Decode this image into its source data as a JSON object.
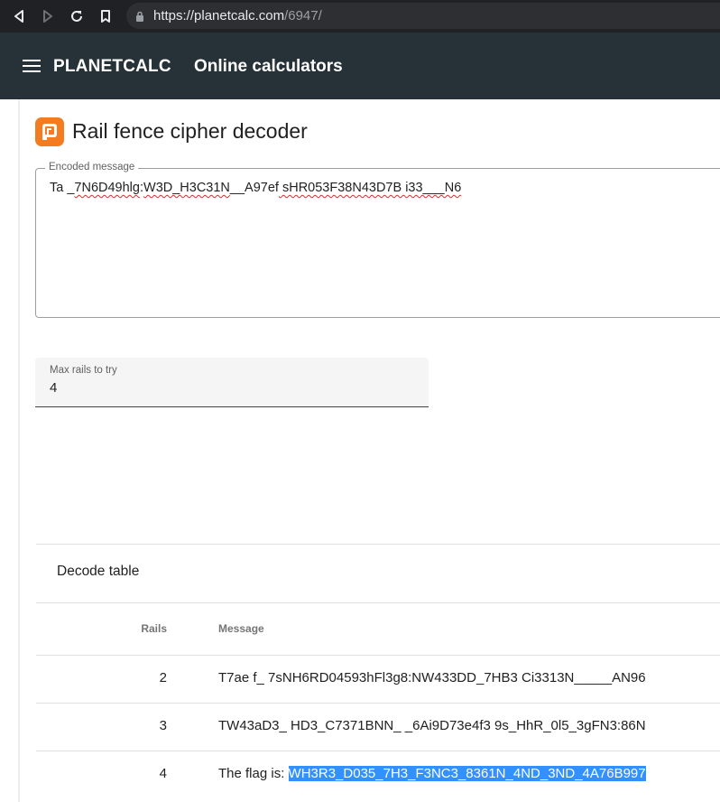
{
  "browser": {
    "url_host": "https://planetcalc.com",
    "url_path": "/6947/",
    "icons": [
      "back-icon",
      "forward-icon",
      "reload-icon",
      "bookmark-icon",
      "lock-icon"
    ]
  },
  "header": {
    "brand": "PLANETCALC",
    "nav_title": "Online calculators"
  },
  "calculator": {
    "title": "Rail fence cipher decoder",
    "encoded_label": "Encoded message",
    "encoded_value": {
      "p1": "Ta _",
      "p2": "7N6D49hlg",
      "p3": ":",
      "p4": "W3D_H3C31N",
      "p5": "__A97ef",
      "p6": " sHR053F38N43D7B ",
      "p7": "i33___N6"
    },
    "max_rails_label": "Max rails to try",
    "max_rails_value": "4"
  },
  "decode_table": {
    "caption": "Decode table",
    "headers": {
      "rails": "Rails",
      "message": "Message"
    },
    "rows": [
      {
        "rails": "2",
        "message": "T7ae f_ 7sNH6RD04593hFl3g8:NW433DD_7HB3 Ci3313N_____AN96"
      },
      {
        "rails": "3",
        "message": "TW43aD3_ HD3_C7371BNN_ _6Ai9D73e4f3 9s_HhR_0l5_3gFN3:86N"
      },
      {
        "rails": "4",
        "message_prefix": "The flag is: ",
        "message_highlight": "WH3R3_D035_7H3_F3NC3_8361N_4ND_3ND_4A76B997"
      }
    ]
  },
  "colors": {
    "header_bg": "#263238",
    "browser_bg": "#202124",
    "logo_orange": "#f47c20",
    "selection": "#3390ff"
  }
}
